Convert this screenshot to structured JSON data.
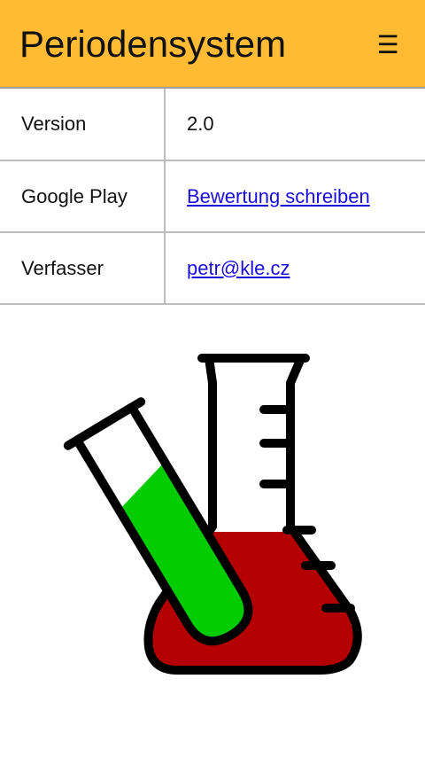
{
  "appbar": {
    "title": "Periodensystem",
    "menu_icon": "hamburger-menu-icon",
    "menu_glyph": "☰",
    "background_color": "#FEBB33"
  },
  "info": {
    "rows": [
      {
        "label": "Version",
        "value": "2.0",
        "is_link": false
      },
      {
        "label": "Google Play",
        "value": "Bewertung schreiben",
        "is_link": true
      },
      {
        "label": "Verfasser",
        "value": "petr@kle.cz",
        "is_link": true
      }
    ],
    "link_color": "#1A0DDB"
  },
  "illustration": {
    "icon": "chemistry-flask-test-tube-icon",
    "test_tube_liquid_color": "#00CC00",
    "flask_liquid_color": "#B40000"
  }
}
